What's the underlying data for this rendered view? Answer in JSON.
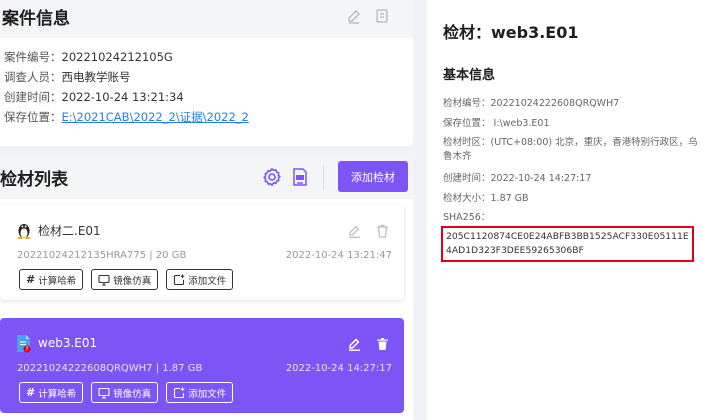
{
  "case": {
    "title": "案件信息",
    "rows": [
      {
        "label": "案件编号：",
        "value": "20221024212105G"
      },
      {
        "label": "调查人员：",
        "value": "西电教学账号"
      },
      {
        "label": "创建时间：",
        "value": "2022-10-24 13:21:34"
      },
      {
        "label": "保存位置：",
        "value": "E:\\2021CAB\\2022_2\\证据\\2022_2"
      }
    ]
  },
  "evidence_list": {
    "title": "检材列表",
    "add_button": "添加检材",
    "items": [
      {
        "name": "检材二.E01",
        "id_size": "20221024212135HRA775 | 20 GB",
        "time": "2022-10-24 13:21:47",
        "icon": "linux-tux-icon",
        "selected": false
      },
      {
        "name": "web3.E01",
        "id_size": "20221024222608QRQWH7 | 1.87 GB",
        "time": "2022-10-24 14:27:17",
        "icon": "unknown-file-icon",
        "selected": true
      }
    ],
    "actions": {
      "hash": "计算哈希",
      "mirror": "镜像仿真",
      "add_file": "添加文件"
    }
  },
  "detail": {
    "title": "检材：web3.E01",
    "section": "基本信息",
    "rows": [
      "检材编号：20221024222608QRQWH7",
      "保存位置： I:\\web3.E01",
      "检材时区：(UTC+08:00) 北京，重庆，香港特别行政区，乌鲁木齐",
      "创建时间：2022-10-24 14:27:17",
      "检材大小：1.87 GB",
      "SHA256："
    ],
    "sha256": "205C1120874CE0E24ABFB3BB1525ACF330E05111E4AD1D323F3DEE59265306BF"
  },
  "colors": {
    "accent": "#7d55f7",
    "highlight_border": "#e0001b",
    "link": "#2a7de1"
  }
}
